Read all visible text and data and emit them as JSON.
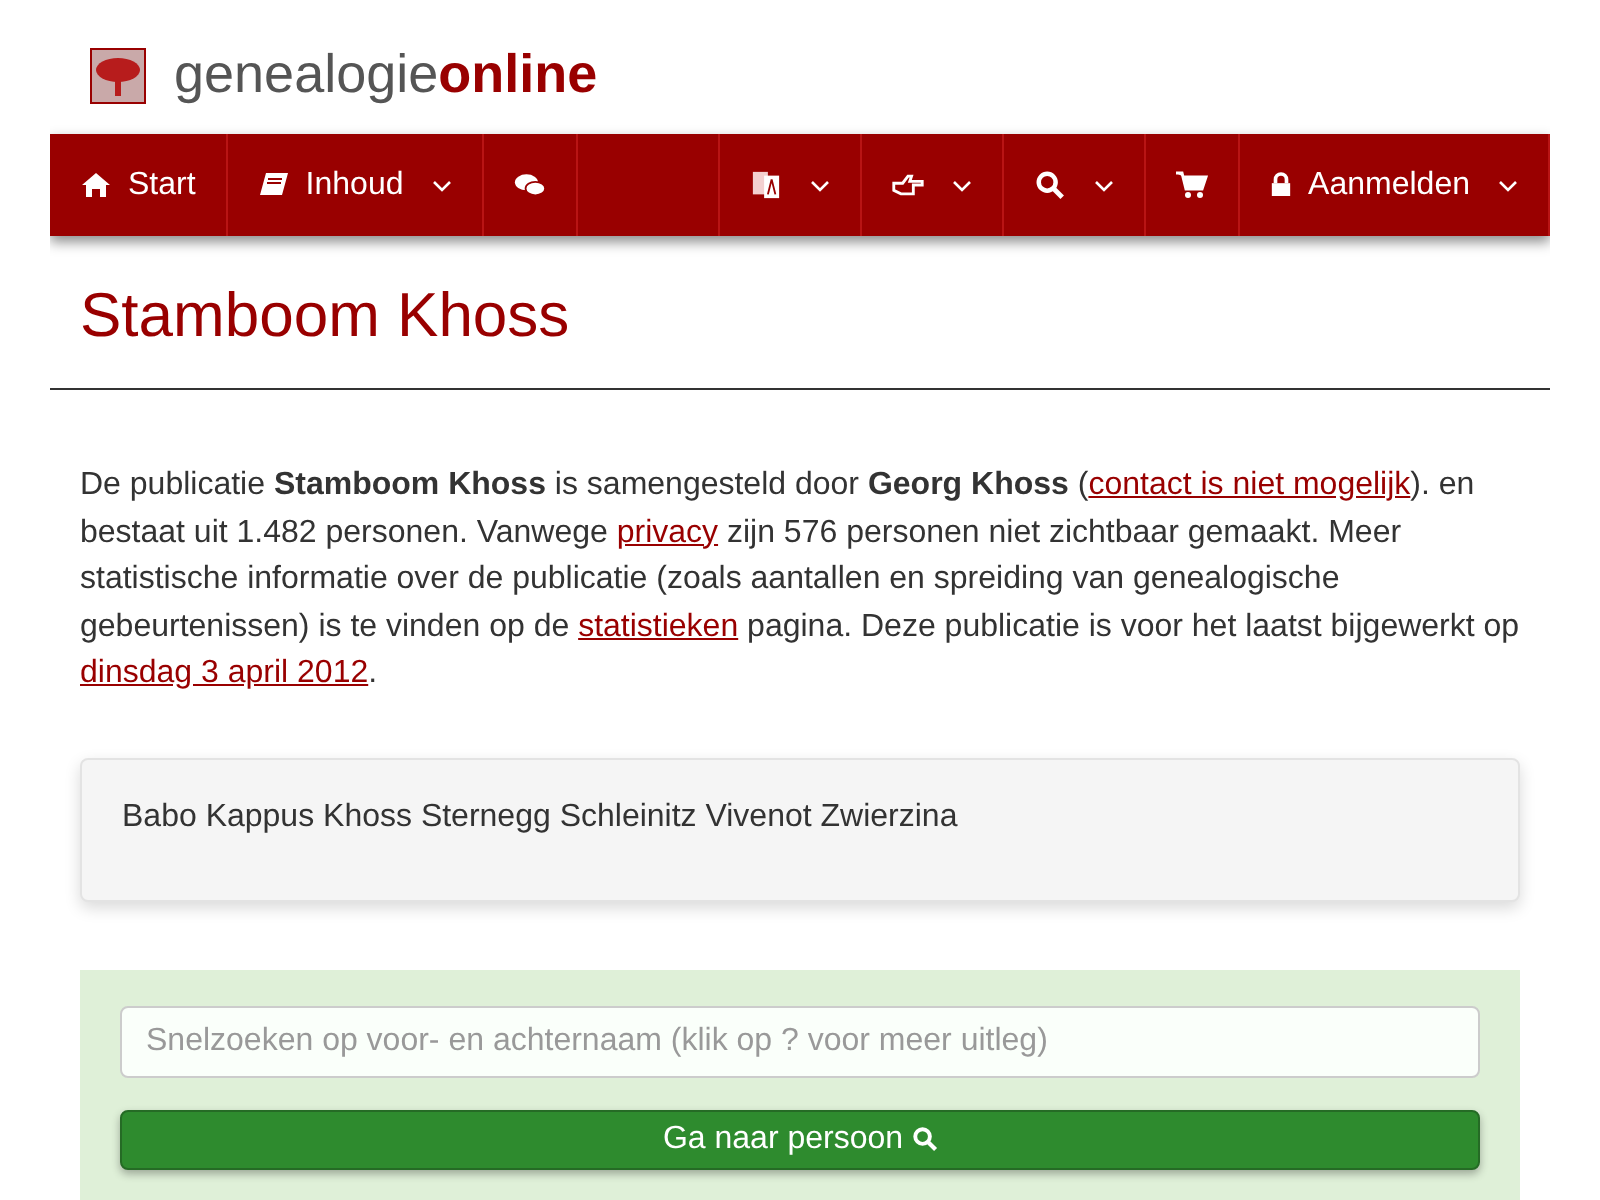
{
  "logo": {
    "part_1": "genealogie",
    "part_2": "online"
  },
  "nav": [
    {
      "kind": "home",
      "label": "Start",
      "dropdown": false
    },
    {
      "kind": "book",
      "label": "Inhoud",
      "dropdown": true
    },
    {
      "kind": "chat",
      "dropdown": false
    },
    {
      "kind": "spacer"
    },
    {
      "kind": "translate",
      "dropdown": true
    },
    {
      "kind": "hand",
      "dropdown": true
    },
    {
      "kind": "search",
      "dropdown": true
    },
    {
      "kind": "cart",
      "dropdown": false
    },
    {
      "kind": "lock",
      "label": "Aanmelden",
      "dropdown": true
    }
  ],
  "title": "Stamboom Khoss",
  "intro": [
    {
      "kind": "text",
      "text": "De publicatie **Stamboom Khoss** is samengesteld door **Georg Khoss** ("
    },
    {
      "kind": "link",
      "text": "contact is niet mogelijk"
    },
    {
      "kind": "text",
      "text": "). en bestaat uit 1.482 personen. Vanwege "
    },
    {
      "kind": "link",
      "text": "privacy"
    },
    {
      "kind": "text",
      "text": " zijn 576 personen niet zichtbaar gemaakt. Meer statistische informatie over de publicatie (zoals aantallen en spreiding van genealogische gebeurtenissen) is te vinden op de "
    },
    {
      "kind": "link",
      "text": "statistieken"
    },
    {
      "kind": "text",
      "text": " pagina. Deze publicatie is voor het laatst bijgewerkt op "
    },
    {
      "kind": "link",
      "text": "dinsdag 3 april 2012"
    },
    {
      "kind": "text",
      "text": "."
    }
  ],
  "surnames": "Babo Kappus Khoss Sternegg Schleinitz Vivenot Zwierzina",
  "search": {
    "placeholder": "Snelzoeken op voor- en achternaam (klik op ? voor meer uitleg)",
    "button": "Ga naar persoon"
  }
}
